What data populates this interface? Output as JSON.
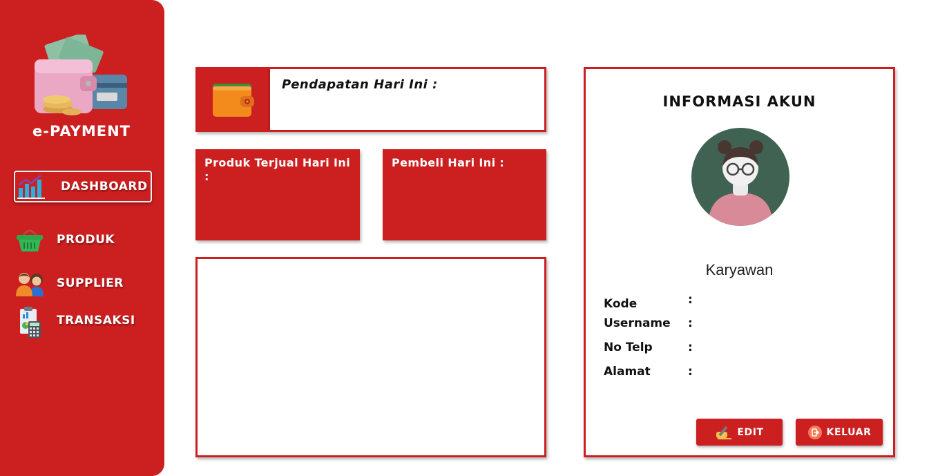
{
  "sidebar": {
    "brand": "e-PAYMENT",
    "items": [
      {
        "label": "DASHBOARD",
        "icon": "chart-icon",
        "active": true
      },
      {
        "label": "PRODUK",
        "icon": "basket-icon"
      },
      {
        "label": "SUPPLIER",
        "icon": "people-icon"
      },
      {
        "label": "TRANSAKSI",
        "icon": "calculator-report-icon"
      }
    ]
  },
  "dashboard": {
    "income_label": "Pendapatan Hari Ini :",
    "sold_label": "Produk Terjual Hari Ini :",
    "buyer_label": "Pembeli Hari Ini :"
  },
  "account": {
    "title": "INFORMASI AKUN",
    "role": "Karyawan",
    "fields": [
      {
        "label": "Kode",
        "separator": ":"
      },
      {
        "label": "Username",
        "separator": ":"
      },
      {
        "label": "No Telp",
        "separator": ":"
      },
      {
        "label": "Alamat",
        "separator": ":"
      }
    ],
    "edit_label": "EDIT",
    "logout_label": "KELUAR"
  },
  "colors": {
    "accent": "#cc1f20",
    "background": "#ffffff"
  }
}
